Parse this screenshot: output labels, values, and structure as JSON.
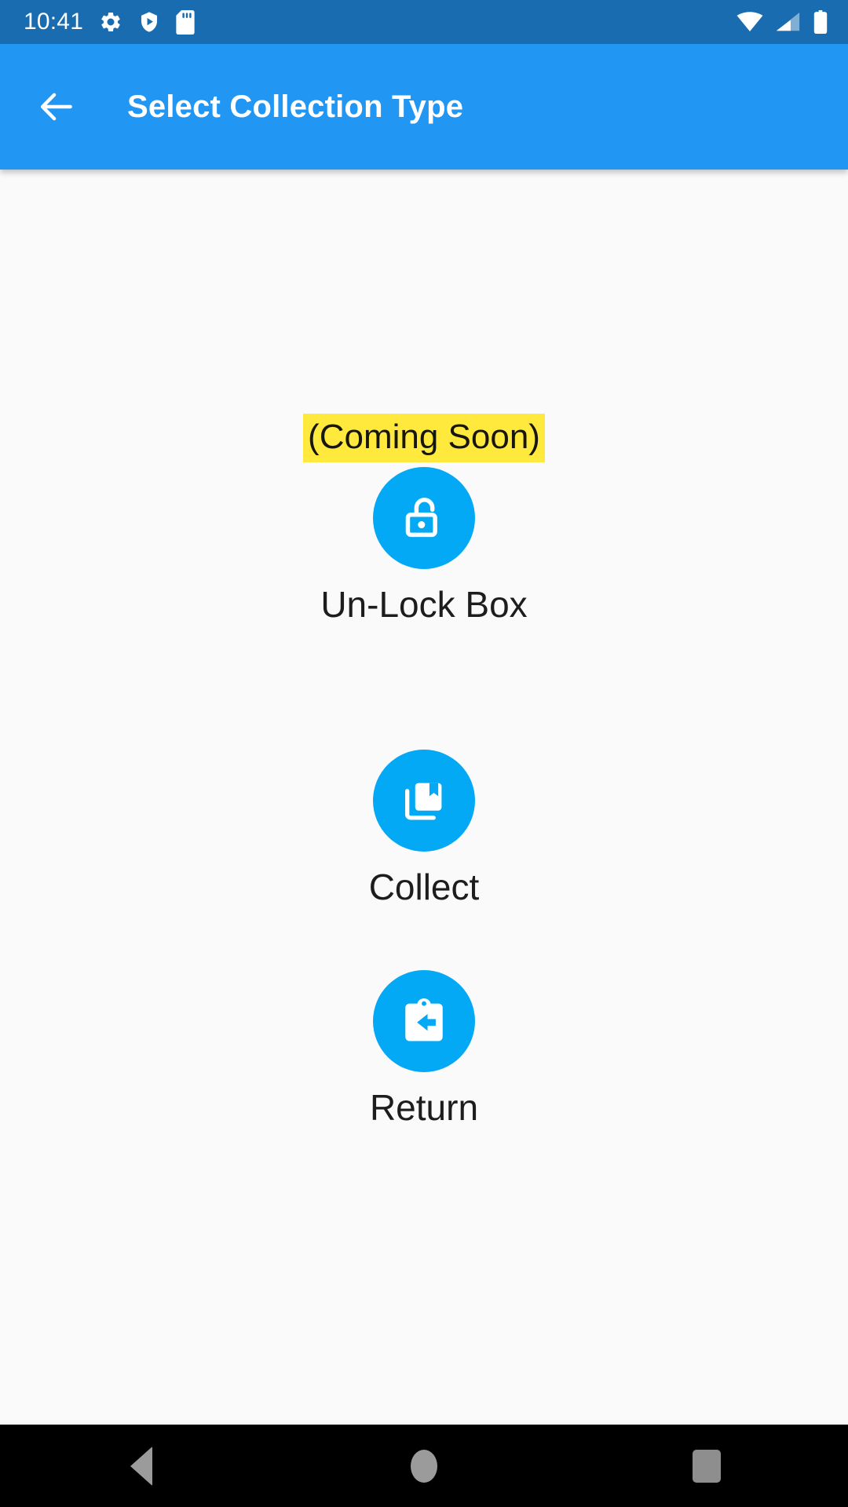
{
  "status_bar": {
    "clock": "10:41",
    "left_icons": [
      "settings-gear-icon",
      "play-protect-shield-icon",
      "sd-card-icon"
    ],
    "right_icons": [
      "wifi-icon",
      "cellular-signal-icon",
      "battery-icon"
    ],
    "background_color": "#1a6cb0"
  },
  "app_bar": {
    "back_icon": "back-arrow-icon",
    "title": "Select Collection Type",
    "background_color": "#2196f3",
    "text_color": "#ffffff"
  },
  "content": {
    "background_color": "#fafafa",
    "coming_soon_badge": {
      "text": "(Coming Soon)",
      "highlight_color": "#ffe93d",
      "text_color": "#16160f"
    },
    "options": [
      {
        "id": "un-lock-box",
        "label": "Un-Lock Box",
        "icon": "unlock-padlock-icon",
        "circle_color": "#03a9f4",
        "icon_color": "#ffffff",
        "badge": "(Coming Soon)"
      },
      {
        "id": "collect",
        "label": "Collect",
        "icon": "library-books-icon",
        "circle_color": "#03a9f4",
        "icon_color": "#ffffff"
      },
      {
        "id": "return",
        "label": "Return",
        "icon": "assignment-return-icon",
        "circle_color": "#03a9f4",
        "icon_color": "#ffffff"
      }
    ]
  },
  "nav_bar": {
    "background_color": "#000000",
    "icon_color": "#9b9b9b",
    "buttons": [
      "back-triangle-icon",
      "home-circle-icon",
      "recents-square-icon"
    ]
  }
}
